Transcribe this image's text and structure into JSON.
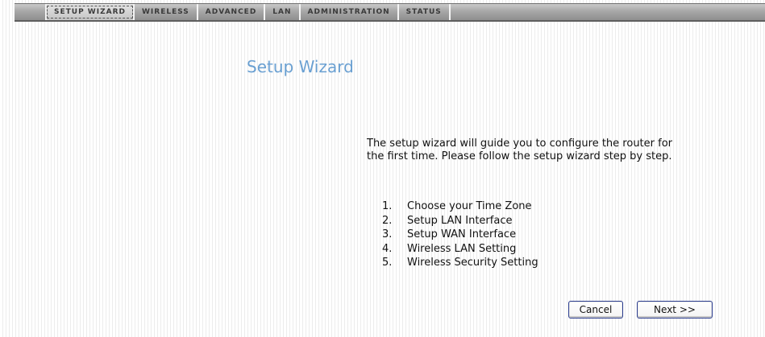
{
  "nav": {
    "tabs": [
      {
        "label": "Setup Wizard"
      },
      {
        "label": "Wireless"
      },
      {
        "label": "Advanced"
      },
      {
        "label": "LAN"
      },
      {
        "label": "Administration"
      },
      {
        "label": "Status"
      }
    ]
  },
  "main": {
    "title": "Setup Wizard",
    "intro": "The setup wizard will guide you to configure the router for the first time. Please follow the setup wizard step by step.",
    "steps": [
      {
        "num": "1.",
        "label": "Choose your Time Zone"
      },
      {
        "num": "2.",
        "label": "Setup LAN Interface"
      },
      {
        "num": "3.",
        "label": "Setup WAN Interface"
      },
      {
        "num": "4.",
        "label": "Wireless LAN Setting"
      },
      {
        "num": "5.",
        "label": "Wireless Security Setting"
      }
    ]
  },
  "buttons": {
    "cancel": "Cancel",
    "next": "Next >>"
  },
  "colors": {
    "title": "#6aa0d2",
    "button_border": "#2b3d8f"
  }
}
